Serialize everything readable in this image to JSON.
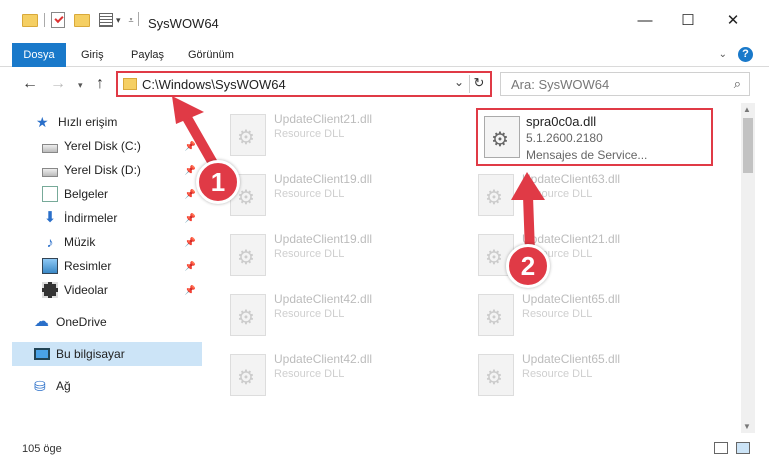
{
  "window": {
    "title": "SysWOW64",
    "minimize": "—",
    "maximize": "☐",
    "close": "✕"
  },
  "ribbon": {
    "tabs": [
      "Dosya",
      "Giriş",
      "Paylaş",
      "Görünüm"
    ],
    "help": "?"
  },
  "address": {
    "path": "C:\\Windows\\SysWOW64",
    "search_placeholder": "Ara: SysWOW64"
  },
  "sidebar": {
    "quick_access": "Hızlı erişim",
    "items": [
      "Yerel Disk (C:)",
      "Yerel Disk (D:)",
      "Belgeler",
      "İndirmeler",
      "Müzik",
      "Resimler",
      "Videolar"
    ],
    "onedrive": "OneDrive",
    "this_pc": "Bu bilgisayar",
    "network": "Ağ"
  },
  "files_left": [
    {
      "name": "UpdateClient21.dll",
      "desc": "Resource DLL"
    },
    {
      "name": "UpdateClient19.dll",
      "desc": "Resource DLL"
    },
    {
      "name": "UpdateClient19.dll",
      "desc": "Resource DLL"
    },
    {
      "name": "UpdateClient42.dll",
      "desc": "Resource DLL"
    },
    {
      "name": "UpdateClient42.dll",
      "desc": "Resource DLL"
    }
  ],
  "highlighted_file": {
    "name": "spra0c0a.dll",
    "version": "5.1.2600.2180",
    "desc": "Mensajes de Service..."
  },
  "files_right": [
    {
      "name": "UpdateClient63.dll",
      "desc": "Resource DLL"
    },
    {
      "name": "UpdateClient21.dll",
      "desc": "Resource DLL"
    },
    {
      "name": "UpdateClient65.dll",
      "desc": "Resource DLL"
    },
    {
      "name": "UpdateClient65.dll",
      "desc": "Resource DLL"
    }
  ],
  "status": {
    "item_count": "105 öge"
  },
  "annotations": {
    "step1": "1",
    "step2": "2",
    "color": "#e03a46"
  }
}
